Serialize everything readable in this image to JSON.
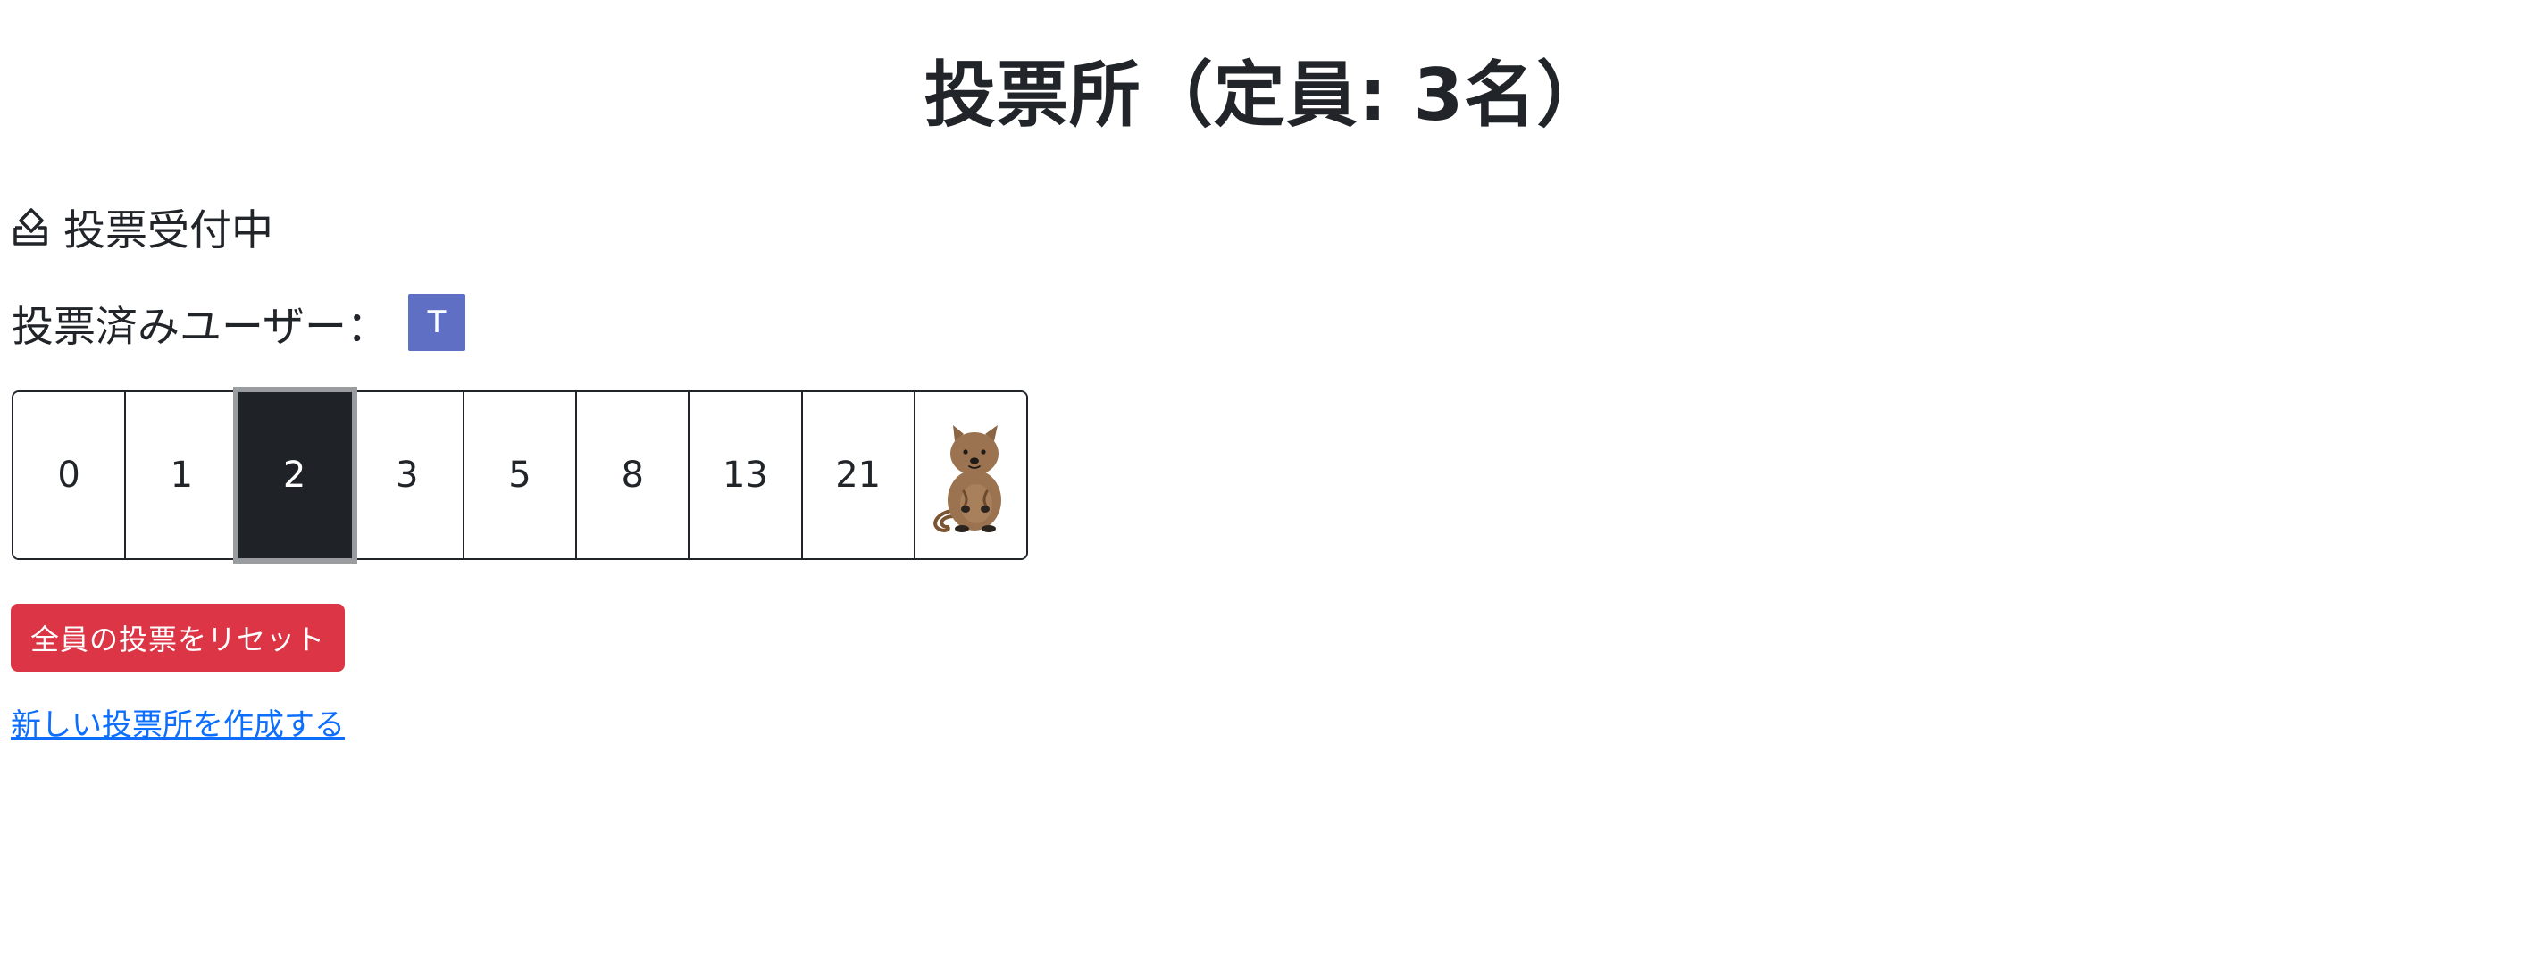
{
  "header": {
    "title": "投票所（定員: 3名）"
  },
  "status": {
    "icon": "ballot-box-icon",
    "text": "投票受付中"
  },
  "voted_users": {
    "label": "投票済みユーザー：",
    "users": [
      "T"
    ],
    "badge_color": "#5f6fc4"
  },
  "cards": {
    "values": [
      "0",
      "1",
      "2",
      "3",
      "5",
      "8",
      "13",
      "21"
    ],
    "special_icon": "quokka-icon",
    "selected": "2"
  },
  "actions": {
    "reset_label": "全員の投票をリセット",
    "reset_color": "#dc3545",
    "new_room_link": "新しい投票所を作成する",
    "link_color": "#0d6efd"
  }
}
